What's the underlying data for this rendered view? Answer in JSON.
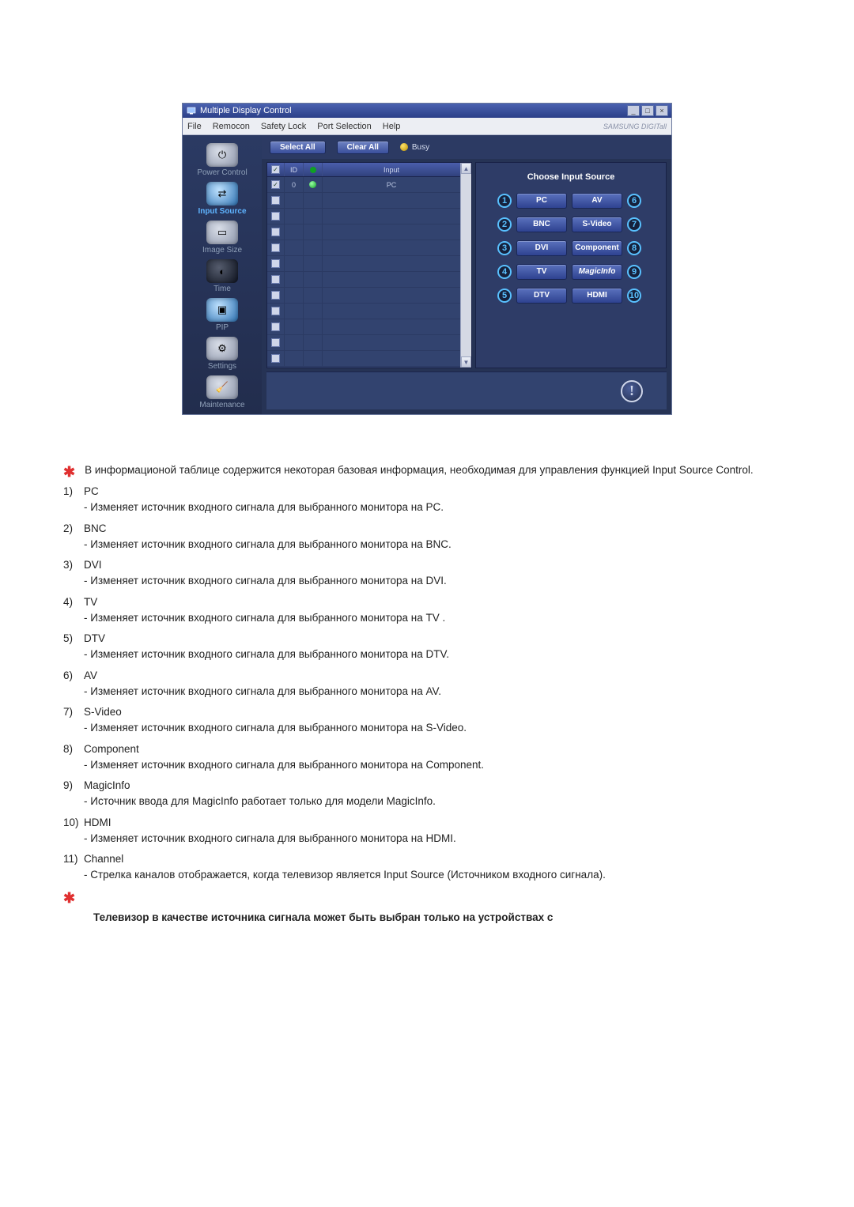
{
  "window": {
    "title": "Multiple Display Control",
    "menu": [
      "File",
      "Remocon",
      "Safety Lock",
      "Port Selection",
      "Help"
    ],
    "brand": "SAMSUNG DIGITall"
  },
  "sidebar": [
    {
      "label": "Power Control",
      "selected": false
    },
    {
      "label": "Input Source",
      "selected": true
    },
    {
      "label": "Image Size",
      "selected": false
    },
    {
      "label": "Time",
      "selected": false
    },
    {
      "label": "PIP",
      "selected": false
    },
    {
      "label": "Settings",
      "selected": false
    },
    {
      "label": "Maintenance",
      "selected": false
    }
  ],
  "toolbar": {
    "select_all": "Select All",
    "clear_all": "Clear All",
    "busy": "Busy"
  },
  "table": {
    "headers": {
      "id": "ID",
      "input": "Input"
    },
    "rows": [
      {
        "checked": true,
        "id": "0",
        "status": true,
        "input": "PC"
      },
      {
        "checked": false,
        "id": "",
        "status": false,
        "input": ""
      },
      {
        "checked": false,
        "id": "",
        "status": false,
        "input": ""
      },
      {
        "checked": false,
        "id": "",
        "status": false,
        "input": ""
      },
      {
        "checked": false,
        "id": "",
        "status": false,
        "input": ""
      },
      {
        "checked": false,
        "id": "",
        "status": false,
        "input": ""
      },
      {
        "checked": false,
        "id": "",
        "status": false,
        "input": ""
      },
      {
        "checked": false,
        "id": "",
        "status": false,
        "input": ""
      },
      {
        "checked": false,
        "id": "",
        "status": false,
        "input": ""
      },
      {
        "checked": false,
        "id": "",
        "status": false,
        "input": ""
      },
      {
        "checked": false,
        "id": "",
        "status": false,
        "input": ""
      },
      {
        "checked": false,
        "id": "",
        "status": false,
        "input": ""
      }
    ]
  },
  "panel": {
    "title": "Choose Input Source",
    "sources": [
      {
        "n": "1",
        "label": "PC"
      },
      {
        "n": "2",
        "label": "BNC"
      },
      {
        "n": "3",
        "label": "DVI"
      },
      {
        "n": "4",
        "label": "TV"
      },
      {
        "n": "5",
        "label": "DTV"
      },
      {
        "n": "6",
        "label": "AV"
      },
      {
        "n": "7",
        "label": "S-Video"
      },
      {
        "n": "8",
        "label": "Component"
      },
      {
        "n": "9",
        "label": "MagicInfo"
      },
      {
        "n": "10",
        "label": "HDMI"
      }
    ]
  },
  "doc": {
    "note1": "В информационой таблице содержится некоторая базовая информация, необходимая для управления функцией Input Source Control.",
    "items": [
      {
        "n": "1)",
        "t": "PC",
        "d": "- Изменяет источник входного сигнала для выбранного монитора на PC."
      },
      {
        "n": "2)",
        "t": "BNC",
        "d": "- Изменяет источник входного сигнала для выбранного монитора на BNC."
      },
      {
        "n": "3)",
        "t": "DVI",
        "d": "- Изменяет источник входного сигнала для выбранного монитора на DVI."
      },
      {
        "n": "4)",
        "t": "TV",
        "d": "- Изменяет источник входного сигнала для выбранного монитора на TV ."
      },
      {
        "n": "5)",
        "t": "DTV",
        "d": "- Изменяет источник входного сигнала для выбранного монитора на DTV."
      },
      {
        "n": "6)",
        "t": "AV",
        "d": "- Изменяет источник входного сигнала для выбранного монитора на AV."
      },
      {
        "n": "7)",
        "t": "S-Video",
        "d": "- Изменяет источник входного сигнала для выбранного монитора на S-Video."
      },
      {
        "n": "8)",
        "t": "Component",
        "d": "- Изменяет источник входного сигнала для выбранного монитора на Component."
      },
      {
        "n": "9)",
        "t": "MagicInfo",
        "d": "- Источник ввода для MagicInfo работает только для модели MagicInfo."
      },
      {
        "n": "10)",
        "t": "HDMI",
        "d": "- Изменяет источник входного сигнала для выбранного монитора на HDMI."
      },
      {
        "n": "11)",
        "t": "Channel",
        "d": "- Стрелка каналов отображается, когда телевизор является Input Source (Источником входного сигнала)."
      }
    ],
    "note2": "Телевизор в качестве источника сигнала может быть выбран только на устройствах с"
  }
}
